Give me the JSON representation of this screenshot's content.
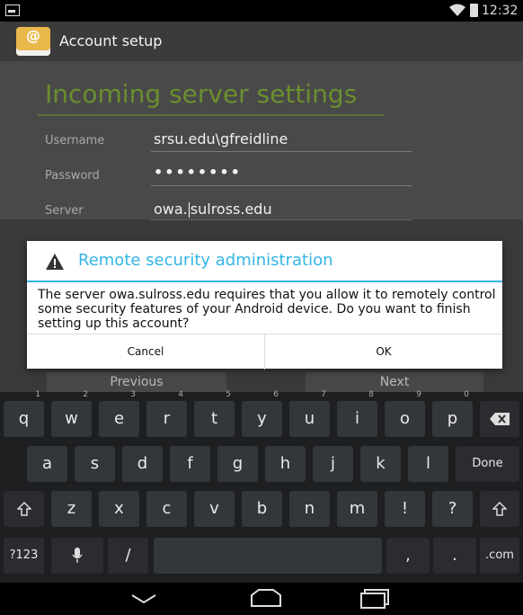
{
  "status_bar": {
    "time": "12:32"
  },
  "action_bar": {
    "title": "Account setup",
    "app_icon": "email-app-icon"
  },
  "form": {
    "heading": "Incoming server settings",
    "username_label": "Username",
    "username_value": "srsu.edu\\gfreidline",
    "password_label": "Password",
    "password_value": "••••••••",
    "server_label": "Server",
    "server_value_before_cursor": "owa.",
    "server_value_after_cursor": "sulross.edu"
  },
  "dialog": {
    "title": "Remote security administration",
    "icon": "warning-icon",
    "message": "The server owa.sulross.edu requires that you allow it to remotely control some security features of your Android device. Do you want to finish setting up this account?",
    "cancel_label": "Cancel",
    "ok_label": "OK"
  },
  "nav_buttons": {
    "previous_label": "Previous",
    "next_label": "Next"
  },
  "keyboard": {
    "row1": [
      {
        "label": "q",
        "hint": "1"
      },
      {
        "label": "w",
        "hint": "2"
      },
      {
        "label": "e",
        "hint": "3"
      },
      {
        "label": "r",
        "hint": "4"
      },
      {
        "label": "t",
        "hint": "5"
      },
      {
        "label": "y",
        "hint": "6"
      },
      {
        "label": "u",
        "hint": "7"
      },
      {
        "label": "i",
        "hint": "8"
      },
      {
        "label": "o",
        "hint": "9"
      },
      {
        "label": "p",
        "hint": "0"
      }
    ],
    "row2": [
      "a",
      "s",
      "d",
      "f",
      "g",
      "h",
      "j",
      "k",
      "l"
    ],
    "done_label": "Done",
    "row3": [
      "z",
      "x",
      "c",
      "v",
      "b",
      "n",
      "m",
      "!",
      "?"
    ],
    "symbols_label": "?123",
    "slash_label": "/",
    "comma_label": ",",
    "period_label": ".",
    "dotcom_label": ".com"
  },
  "colors": {
    "accent": "#33b5e5",
    "heading": "#6a8f2f",
    "background": "#494949",
    "keyboard": "#1e1f21"
  }
}
